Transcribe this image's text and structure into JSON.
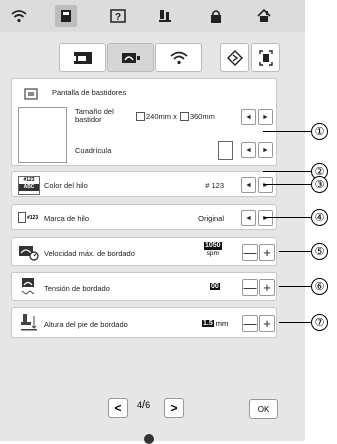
{
  "frame": {
    "title": "Pantalla de bastidores",
    "size_label_line1": "Tamaño del",
    "size_label_line2": "bastidor",
    "size_width": "240mm x",
    "size_height": "360mm",
    "grid_label": "Cuadrícula"
  },
  "rows": {
    "thread_color": {
      "label": "Color del hilo",
      "value": "# 123",
      "icon_text_1": "#123",
      "icon_text_2": "ABC"
    },
    "thread_brand": {
      "label": "Marca de hilo",
      "value": "Original",
      "icon_text": "#123"
    },
    "max_speed": {
      "label": "Velocidad máx. de bordado",
      "value": "1050",
      "unit": "spm"
    },
    "tension": {
      "label": "Tensión de bordado",
      "value": "00"
    },
    "foot_height": {
      "label": "Altura del pie de bordado",
      "value": "1.5",
      "unit": "mm"
    }
  },
  "pager": {
    "current": "4",
    "total": "6"
  },
  "ok_label": "OK",
  "callouts": [
    "①",
    "②",
    "③",
    "④",
    "⑤",
    "⑥",
    "⑦"
  ],
  "arrow_left": "◄",
  "arrow_right": "►",
  "minus": "—",
  "plus": "+",
  "nav_prev": "<",
  "nav_next": ">",
  "colors": {
    "panel": "#e6e6e6",
    "topbar": "#dcdcdc",
    "row_bg": "#ffffff",
    "border": "#c8c8c8"
  }
}
